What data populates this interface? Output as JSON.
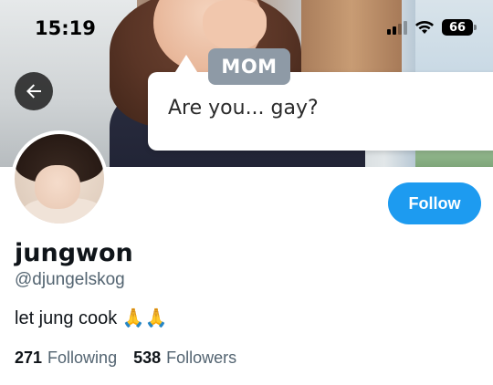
{
  "status_bar": {
    "time": "15:19",
    "battery_level": "66",
    "signal_bars_active": 2,
    "signal_bars_total": 4
  },
  "banner": {
    "speaker_label": "MOM",
    "speech_text": "Are you... gay?"
  },
  "icons": {
    "back": "arrow-left-icon",
    "wifi": "wifi-icon",
    "signal": "cellular-signal-icon",
    "battery": "battery-icon"
  },
  "profile": {
    "display_name": "jungwon",
    "handle": "@djungelskog",
    "bio": "let jung cook 🙏🙏",
    "follow_label": "Follow",
    "following_count": "271",
    "following_label": "Following",
    "followers_count": "538",
    "followers_label": "Followers"
  },
  "colors": {
    "accent": "#1d9bf0",
    "secondary_text": "#536471",
    "primary_text": "#0f1419"
  }
}
